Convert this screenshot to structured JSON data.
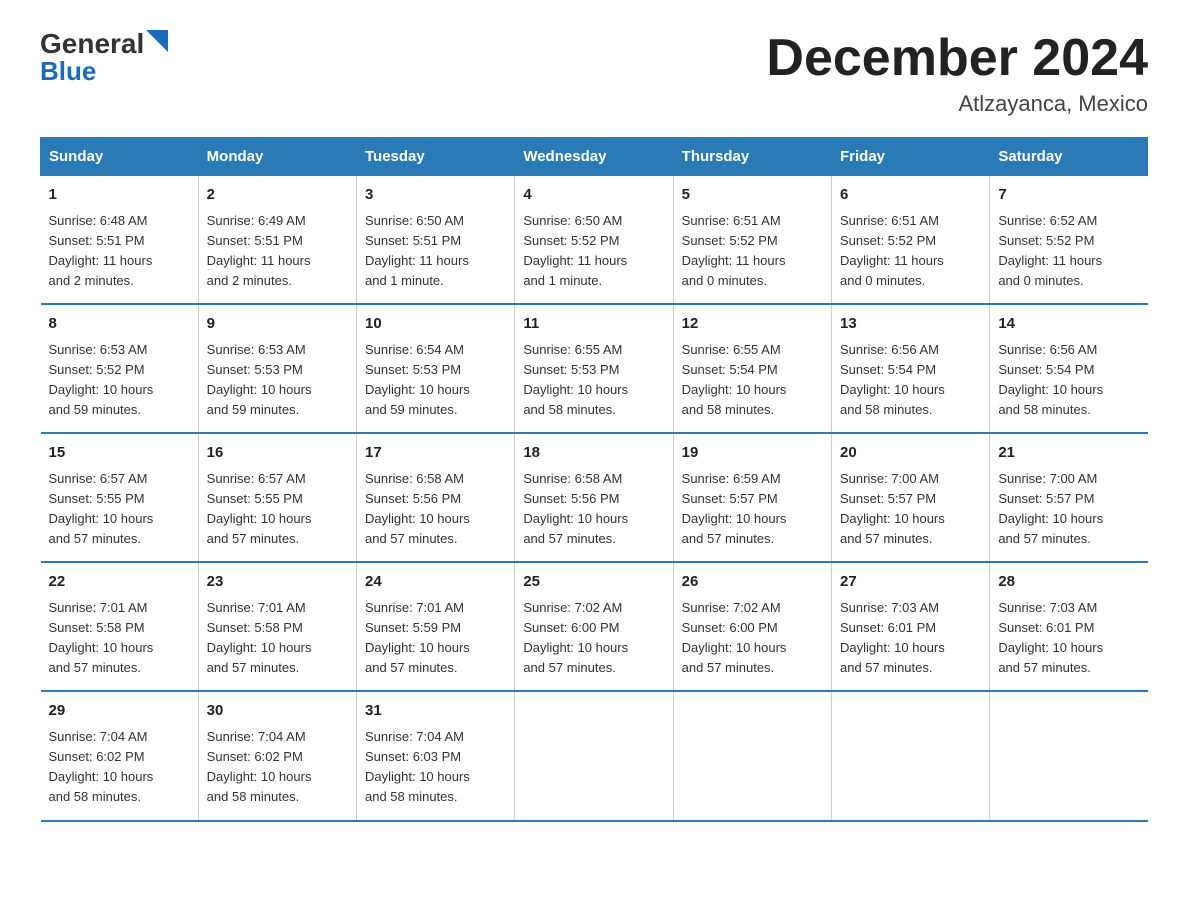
{
  "logo": {
    "text1": "General",
    "text2": "Blue"
  },
  "title": "December 2024",
  "location": "Atlzayanca, Mexico",
  "days_of_week": [
    "Sunday",
    "Monday",
    "Tuesday",
    "Wednesday",
    "Thursday",
    "Friday",
    "Saturday"
  ],
  "weeks": [
    [
      {
        "day": "1",
        "info": "Sunrise: 6:48 AM\nSunset: 5:51 PM\nDaylight: 11 hours\nand 2 minutes."
      },
      {
        "day": "2",
        "info": "Sunrise: 6:49 AM\nSunset: 5:51 PM\nDaylight: 11 hours\nand 2 minutes."
      },
      {
        "day": "3",
        "info": "Sunrise: 6:50 AM\nSunset: 5:51 PM\nDaylight: 11 hours\nand 1 minute."
      },
      {
        "day": "4",
        "info": "Sunrise: 6:50 AM\nSunset: 5:52 PM\nDaylight: 11 hours\nand 1 minute."
      },
      {
        "day": "5",
        "info": "Sunrise: 6:51 AM\nSunset: 5:52 PM\nDaylight: 11 hours\nand 0 minutes."
      },
      {
        "day": "6",
        "info": "Sunrise: 6:51 AM\nSunset: 5:52 PM\nDaylight: 11 hours\nand 0 minutes."
      },
      {
        "day": "7",
        "info": "Sunrise: 6:52 AM\nSunset: 5:52 PM\nDaylight: 11 hours\nand 0 minutes."
      }
    ],
    [
      {
        "day": "8",
        "info": "Sunrise: 6:53 AM\nSunset: 5:52 PM\nDaylight: 10 hours\nand 59 minutes."
      },
      {
        "day": "9",
        "info": "Sunrise: 6:53 AM\nSunset: 5:53 PM\nDaylight: 10 hours\nand 59 minutes."
      },
      {
        "day": "10",
        "info": "Sunrise: 6:54 AM\nSunset: 5:53 PM\nDaylight: 10 hours\nand 59 minutes."
      },
      {
        "day": "11",
        "info": "Sunrise: 6:55 AM\nSunset: 5:53 PM\nDaylight: 10 hours\nand 58 minutes."
      },
      {
        "day": "12",
        "info": "Sunrise: 6:55 AM\nSunset: 5:54 PM\nDaylight: 10 hours\nand 58 minutes."
      },
      {
        "day": "13",
        "info": "Sunrise: 6:56 AM\nSunset: 5:54 PM\nDaylight: 10 hours\nand 58 minutes."
      },
      {
        "day": "14",
        "info": "Sunrise: 6:56 AM\nSunset: 5:54 PM\nDaylight: 10 hours\nand 58 minutes."
      }
    ],
    [
      {
        "day": "15",
        "info": "Sunrise: 6:57 AM\nSunset: 5:55 PM\nDaylight: 10 hours\nand 57 minutes."
      },
      {
        "day": "16",
        "info": "Sunrise: 6:57 AM\nSunset: 5:55 PM\nDaylight: 10 hours\nand 57 minutes."
      },
      {
        "day": "17",
        "info": "Sunrise: 6:58 AM\nSunset: 5:56 PM\nDaylight: 10 hours\nand 57 minutes."
      },
      {
        "day": "18",
        "info": "Sunrise: 6:58 AM\nSunset: 5:56 PM\nDaylight: 10 hours\nand 57 minutes."
      },
      {
        "day": "19",
        "info": "Sunrise: 6:59 AM\nSunset: 5:57 PM\nDaylight: 10 hours\nand 57 minutes."
      },
      {
        "day": "20",
        "info": "Sunrise: 7:00 AM\nSunset: 5:57 PM\nDaylight: 10 hours\nand 57 minutes."
      },
      {
        "day": "21",
        "info": "Sunrise: 7:00 AM\nSunset: 5:57 PM\nDaylight: 10 hours\nand 57 minutes."
      }
    ],
    [
      {
        "day": "22",
        "info": "Sunrise: 7:01 AM\nSunset: 5:58 PM\nDaylight: 10 hours\nand 57 minutes."
      },
      {
        "day": "23",
        "info": "Sunrise: 7:01 AM\nSunset: 5:58 PM\nDaylight: 10 hours\nand 57 minutes."
      },
      {
        "day": "24",
        "info": "Sunrise: 7:01 AM\nSunset: 5:59 PM\nDaylight: 10 hours\nand 57 minutes."
      },
      {
        "day": "25",
        "info": "Sunrise: 7:02 AM\nSunset: 6:00 PM\nDaylight: 10 hours\nand 57 minutes."
      },
      {
        "day": "26",
        "info": "Sunrise: 7:02 AM\nSunset: 6:00 PM\nDaylight: 10 hours\nand 57 minutes."
      },
      {
        "day": "27",
        "info": "Sunrise: 7:03 AM\nSunset: 6:01 PM\nDaylight: 10 hours\nand 57 minutes."
      },
      {
        "day": "28",
        "info": "Sunrise: 7:03 AM\nSunset: 6:01 PM\nDaylight: 10 hours\nand 57 minutes."
      }
    ],
    [
      {
        "day": "29",
        "info": "Sunrise: 7:04 AM\nSunset: 6:02 PM\nDaylight: 10 hours\nand 58 minutes."
      },
      {
        "day": "30",
        "info": "Sunrise: 7:04 AM\nSunset: 6:02 PM\nDaylight: 10 hours\nand 58 minutes."
      },
      {
        "day": "31",
        "info": "Sunrise: 7:04 AM\nSunset: 6:03 PM\nDaylight: 10 hours\nand 58 minutes."
      },
      {
        "day": "",
        "info": ""
      },
      {
        "day": "",
        "info": ""
      },
      {
        "day": "",
        "info": ""
      },
      {
        "day": "",
        "info": ""
      }
    ]
  ]
}
